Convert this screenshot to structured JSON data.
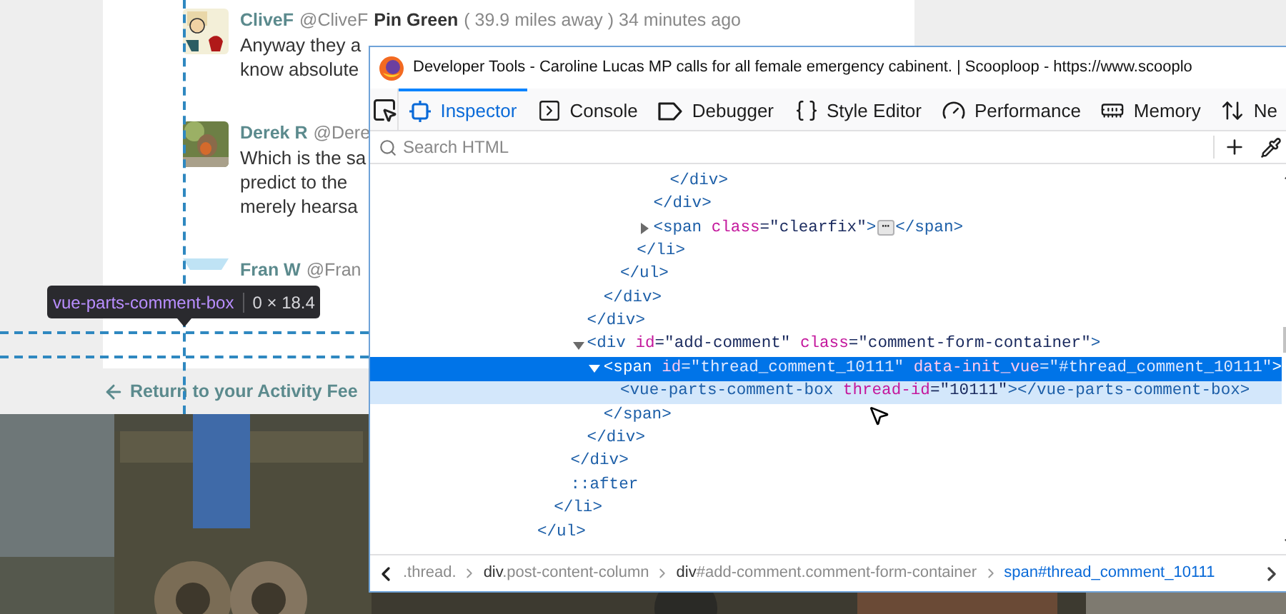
{
  "page": {
    "comments": [
      {
        "name": "CliveF",
        "handle": "@CliveF",
        "location": "Pin Green",
        "meta": "( 39.9 miles away ) 34 minutes ago",
        "body": [
          "Anyway they a",
          "know absolute"
        ]
      },
      {
        "name": "Derek R",
        "handle": "@Dere",
        "body": [
          "Which is the sa",
          "predict to the",
          "merely hearsa"
        ]
      },
      {
        "name": "Fran W",
        "handle": "@Fran"
      }
    ],
    "return_link": "Return to your Activity Fee"
  },
  "highlighter_tooltip": {
    "tag": "vue-parts-comment-box",
    "size": "0 × 18.4"
  },
  "devtools": {
    "title": "Developer Tools - Caroline Lucas MP calls for all female emergency cabinent. | Scooploop - https://www.scooplo",
    "tabs": [
      {
        "label": "Inspector",
        "selected": true
      },
      {
        "label": "Console",
        "selected": false
      },
      {
        "label": "Debugger",
        "selected": false
      },
      {
        "label": "Style Editor",
        "selected": false
      },
      {
        "label": "Performance",
        "selected": false
      },
      {
        "label": "Memory",
        "selected": false
      },
      {
        "label": "Ne",
        "selected": false
      }
    ],
    "search": {
      "placeholder": "Search HTML"
    },
    "tree": [
      {
        "close": "</ul>",
        "selected": false,
        "hovered": false,
        "children": [
          {
            "close": "</li>",
            "selected": false,
            "hovered": false,
            "children": [
              {
                "close": "</div>",
                "selected": false,
                "hovered": false,
                "children": [
                  {
                    "close": "</div>",
                    "selected": false,
                    "hovered": false,
                    "children": [
                      {
                        "close": "</div>",
                        "selected": false,
                        "hovered": false,
                        "children": [
                          {
                            "close": "</ul>",
                            "selected": false,
                            "hovered": false,
                            "children": [
                              {
                                "close": "</li>",
                                "selected": false,
                                "hovered": false,
                                "children": [
                                  {
                                    "close": "</div>",
                                    "selected": false,
                                    "hovered": false,
                                    "children": [
                                      {
                                        "close": "</div>",
                                        "selected": false,
                                        "hovered": false
                                      }
                                    ]
                                  },
                                  {
                                    "open": [
                                      {
                                        "kind": "tag",
                                        "text": "<span"
                                      },
                                      {
                                        "kind": "attr",
                                        "text": " class"
                                      },
                                      {
                                        "kind": "value",
                                        "text": "=\"clearfix\""
                                      },
                                      {
                                        "kind": "tag",
                                        "text": ">"
                                      },
                                      {
                                        "kind": "badge",
                                        "text": "⋯"
                                      },
                                      {
                                        "kind": "tag",
                                        "text": "</span>"
                                      }
                                    ],
                                    "expanded": false,
                                    "selected": false,
                                    "hovered": false
                                  }
                                ]
                              }
                            ]
                          }
                        ]
                      }
                    ]
                  },
                  {
                    "open": [
                      {
                        "kind": "tag",
                        "text": "<div"
                      },
                      {
                        "kind": "attr",
                        "text": " id"
                      },
                      {
                        "kind": "value",
                        "text": "=\"add-comment\""
                      },
                      {
                        "kind": "attr",
                        "text": " class"
                      },
                      {
                        "kind": "value",
                        "text": "=\"comment-form-container\""
                      },
                      {
                        "kind": "tag",
                        "text": ">"
                      }
                    ],
                    "expanded": true,
                    "close": "</div>",
                    "selected": false,
                    "hovered": false,
                    "children": [
                      {
                        "open": [
                          {
                            "kind": "tag",
                            "text": "<span"
                          },
                          {
                            "kind": "attr",
                            "text": " id"
                          },
                          {
                            "kind": "value",
                            "text": "=\"thread_comment_10111\""
                          },
                          {
                            "kind": "attr",
                            "text": " data-init_vue"
                          },
                          {
                            "kind": "value",
                            "text": "=\"#thread_comment_10111\""
                          },
                          {
                            "kind": "tag",
                            "text": ">"
                          }
                        ],
                        "expanded": true,
                        "close": "</span>",
                        "selected": true,
                        "hovered": false,
                        "children": [
                          {
                            "open": [
                              {
                                "kind": "tag",
                                "text": "<vue-parts-comment-box"
                              },
                              {
                                "kind": "attr",
                                "text": " thread-id"
                              },
                              {
                                "kind": "value",
                                "text": "=\"10111\""
                              },
                              {
                                "kind": "tag",
                                "text": "></vue-parts-comment-box>"
                              }
                            ],
                            "selected": false,
                            "hovered": true
                          }
                        ]
                      }
                    ]
                  }
                ]
              },
              {
                "open": [
                  {
                    "kind": "pseudo",
                    "text": "::after"
                  }
                ],
                "selected": false,
                "hovered": false
              }
            ]
          }
        ]
      }
    ],
    "breadcrumbs": [
      {
        "detail": ".thread.",
        "selected": false
      },
      {
        "tag": "div",
        "detail": ".post-content-column",
        "selected": false
      },
      {
        "tag": "div",
        "detail": "#add-comment.comment-form-container",
        "selected": false
      },
      {
        "tag": "span",
        "detail": "#thread_comment_10111",
        "selected": true
      }
    ]
  }
}
